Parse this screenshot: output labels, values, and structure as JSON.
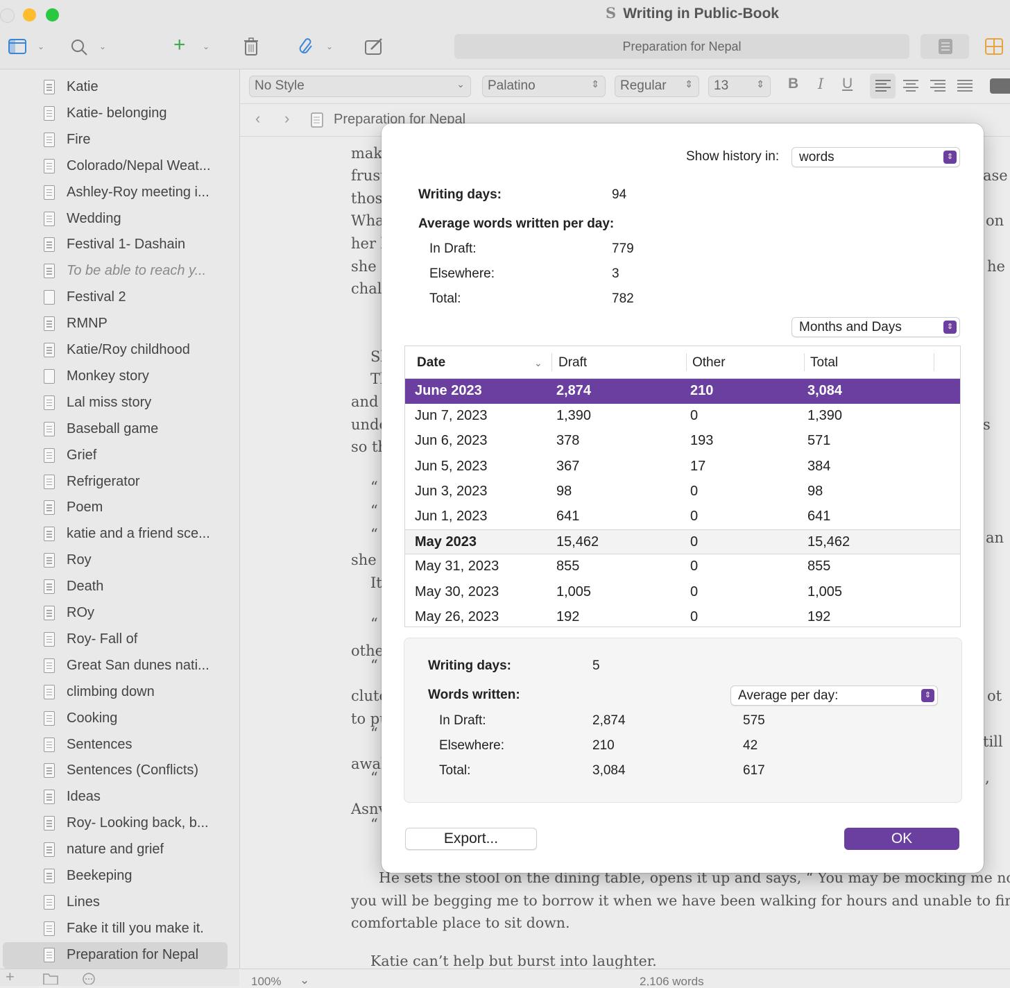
{
  "window": {
    "title": "Writing in Public-Book",
    "title_glyph": "S"
  },
  "toolbar": {
    "document_title": "Preparation for Nepal"
  },
  "binder": {
    "items": [
      {
        "label": "Katie"
      },
      {
        "label": "Katie- belonging"
      },
      {
        "label": "Fire"
      },
      {
        "label": "Colorado/Nepal Weat..."
      },
      {
        "label": "Ashley-Roy meeting i..."
      },
      {
        "label": "Wedding"
      },
      {
        "label": "Festival 1- Dashain"
      },
      {
        "label": "To be able to reach y..."
      },
      {
        "label": "Festival 2"
      },
      {
        "label": "RMNP"
      },
      {
        "label": "Katie/Roy childhood"
      },
      {
        "label": "Monkey story"
      },
      {
        "label": "Lal miss story"
      },
      {
        "label": "Baseball game"
      },
      {
        "label": "Grief"
      },
      {
        "label": "Refrigerator"
      },
      {
        "label": "Poem"
      },
      {
        "label": "katie and a friend sce..."
      },
      {
        "label": "Roy"
      },
      {
        "label": "Death"
      },
      {
        "label": "ROy"
      },
      {
        "label": "Roy- Fall of"
      },
      {
        "label": "Great San dunes nati..."
      },
      {
        "label": "climbing down"
      },
      {
        "label": "Cooking"
      },
      {
        "label": "Sentences"
      },
      {
        "label": "Sentences (Conflicts)"
      },
      {
        "label": "Ideas"
      },
      {
        "label": "Roy- Looking back, b..."
      },
      {
        "label": "nature and grief"
      },
      {
        "label": "Beekeping"
      },
      {
        "label": "Lines"
      },
      {
        "label": "Fake it till you make it."
      },
      {
        "label": "Preparation for Nepal"
      }
    ]
  },
  "format_bar": {
    "style": "No Style",
    "font": "Palatino",
    "weight": "Regular",
    "size": "13",
    "bold": "B",
    "italic": "I",
    "underline": "U"
  },
  "header_bar": {
    "title": "Preparation for Nepal"
  },
  "editor": {
    "fragments": [
      {
        "text": "make"
      },
      {
        "text": "frust"
      },
      {
        "text": "those"
      },
      {
        "text": "Wha"
      },
      {
        "text": "her l"
      },
      {
        "text": "she c"
      },
      {
        "text": "chall"
      },
      {
        "text": "Sl"
      },
      {
        "text": "Tl"
      },
      {
        "text": "and g"
      },
      {
        "text": "unde"
      },
      {
        "text": "so th"
      },
      {
        "text": "“"
      },
      {
        "text": "“"
      },
      {
        "text": "“"
      },
      {
        "text": "she e"
      },
      {
        "text": "It"
      },
      {
        "text": "“"
      },
      {
        "text": "other"
      },
      {
        "text": "“"
      },
      {
        "text": "clutc"
      },
      {
        "text": "to pu"
      },
      {
        "text": "“"
      },
      {
        "text": "awak"
      },
      {
        "text": "“"
      },
      {
        "text": "Asnv"
      },
      {
        "text": "“"
      },
      {
        "text": "ase"
      },
      {
        "text": "on"
      },
      {
        "text": "he"
      },
      {
        "text": "s"
      },
      {
        "text": "an"
      },
      {
        "text": "ot"
      },
      {
        "text": "till"
      },
      {
        "text": ","
      }
    ],
    "para_lines": [
      {
        "text": "He sets the stool on the dining table, opens it up and says, “ You may be mocking me now, but"
      },
      {
        "text": "you will be begging me to borrow it when we have been walking for hours and unable to find a"
      },
      {
        "text": "comfortable place to sit down."
      },
      {
        "text": "Katie can’t help but burst into laughter."
      }
    ]
  },
  "footer": {
    "zoom": "100%",
    "word_count": "2,106 words"
  },
  "dialog": {
    "show_history_label": "Show history in:",
    "show_history_value": "words",
    "writing_days_label": "Writing days:",
    "writing_days_value": "94",
    "avg_label": "Average words written per day:",
    "avg_rows": [
      {
        "label": "In Draft:",
        "value": "779"
      },
      {
        "label": "Elsewhere:",
        "value": "3"
      },
      {
        "label": "Total:",
        "value": "782"
      }
    ],
    "grouping_value": "Months and Days",
    "table": {
      "columns": [
        "Date",
        "Draft",
        "Other",
        "Total"
      ],
      "rows": [
        {
          "kind": "month-selected",
          "date": "June 2023",
          "draft": "2,874",
          "other": "210",
          "total": "3,084"
        },
        {
          "kind": "day",
          "date": "Jun 7, 2023",
          "draft": "1,390",
          "other": "0",
          "total": "1,390"
        },
        {
          "kind": "day",
          "date": "Jun 6, 2023",
          "draft": "378",
          "other": "193",
          "total": "571"
        },
        {
          "kind": "day",
          "date": "Jun 5, 2023",
          "draft": "367",
          "other": "17",
          "total": "384"
        },
        {
          "kind": "day",
          "date": "Jun 3, 2023",
          "draft": "98",
          "other": "0",
          "total": "98"
        },
        {
          "kind": "day",
          "date": "Jun 1, 2023",
          "draft": "641",
          "other": "0",
          "total": "641"
        },
        {
          "kind": "month",
          "date": "May 2023",
          "draft": "15,462",
          "other": "0",
          "total": "15,462"
        },
        {
          "kind": "day",
          "date": "May 31, 2023",
          "draft": "855",
          "other": "0",
          "total": "855"
        },
        {
          "kind": "day",
          "date": "May 30, 2023",
          "draft": "1,005",
          "other": "0",
          "total": "1,005"
        },
        {
          "kind": "day",
          "date": "May 26, 2023",
          "draft": "192",
          "other": "0",
          "total": "192"
        }
      ]
    },
    "summary": {
      "writing_days_label": "Writing days:",
      "writing_days_value": "5",
      "words_written_label": "Words written:",
      "mode_value": "Average per day:",
      "rows": [
        {
          "label": "In Draft:",
          "total": "2,874",
          "avg": "575"
        },
        {
          "label": "Elsewhere:",
          "total": "210",
          "avg": "42"
        },
        {
          "label": "Total:",
          "total": "3,084",
          "avg": "617"
        }
      ]
    },
    "export_label": "Export...",
    "ok_label": "OK"
  },
  "colors": {
    "accent": "#6b3fa0",
    "close": "#ff5f57",
    "minimize": "#febc2e",
    "zoom": "#28c840"
  }
}
